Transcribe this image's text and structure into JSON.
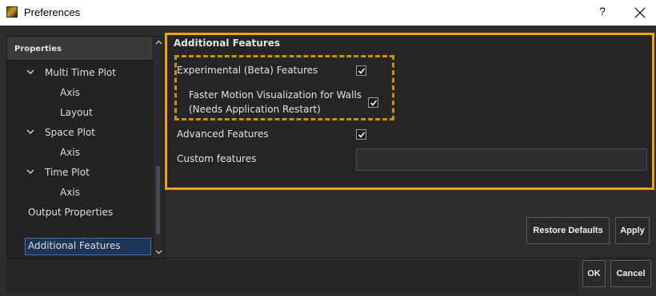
{
  "window": {
    "title": "Preferences",
    "help_label": "?",
    "app_icon": "app-logo-icon",
    "close_icon": "close-icon"
  },
  "sidebar": {
    "header": "Properties",
    "items": [
      {
        "label": "Multi Time Plot",
        "expanded": true,
        "level": 1
      },
      {
        "label": "Axis",
        "level": 2
      },
      {
        "label": "Layout",
        "level": 2
      },
      {
        "label": "Space Plot",
        "expanded": true,
        "level": 1
      },
      {
        "label": "Axis",
        "level": 2
      },
      {
        "label": "Time Plot",
        "expanded": true,
        "level": 1
      },
      {
        "label": "Axis",
        "level": 2
      },
      {
        "label": "Output Properties",
        "level": 1
      },
      {
        "label": "Additional Features",
        "level": 1,
        "selected": true
      }
    ]
  },
  "panel": {
    "title": "Additional Features",
    "highlight_color": "#f5a300",
    "experimental_label": "Experimental (Beta) Features",
    "experimental_checked": true,
    "faster_motion_label_1": "Faster Motion Visualization for Walls",
    "faster_motion_label_2": "(Needs Application Restart)",
    "faster_motion_checked": true,
    "advanced_label": "Advanced Features",
    "advanced_checked": true,
    "custom_label": "Custom features",
    "custom_value": ""
  },
  "buttons": {
    "restore": "Restore Defaults",
    "apply": "Apply",
    "ok": "OK",
    "cancel": "Cancel"
  }
}
